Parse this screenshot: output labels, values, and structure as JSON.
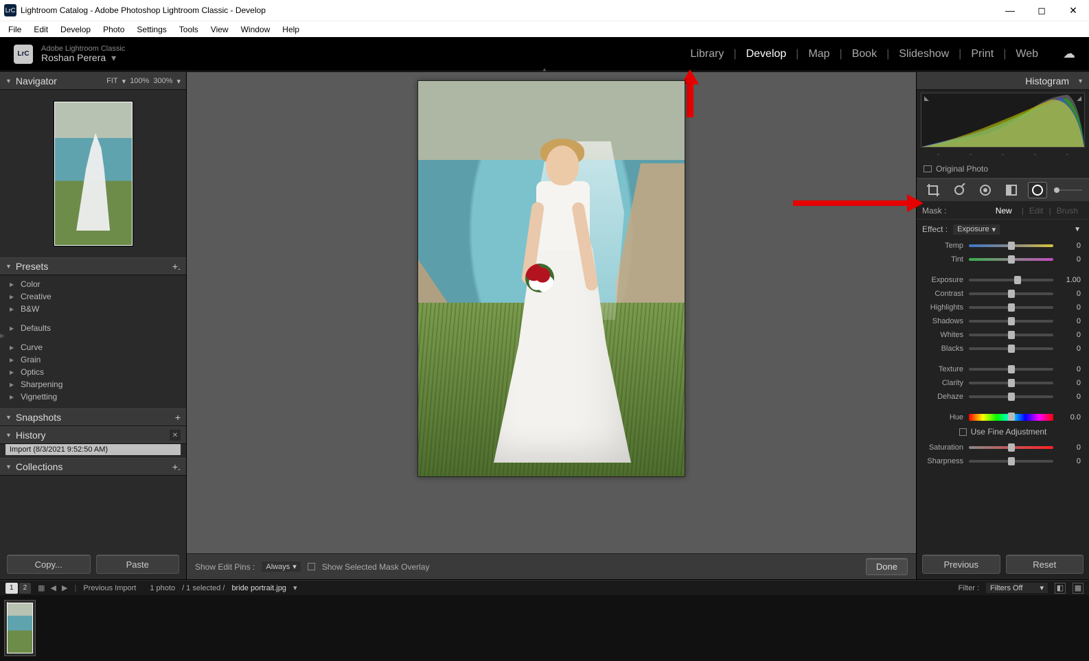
{
  "window": {
    "title": "Lightroom Catalog - Adobe Photoshop Lightroom Classic - Develop"
  },
  "menu": [
    "File",
    "Edit",
    "Develop",
    "Photo",
    "Settings",
    "Tools",
    "View",
    "Window",
    "Help"
  ],
  "brand": {
    "product": "Adobe Lightroom Classic",
    "user": "Roshan Perera"
  },
  "topnav": {
    "items": [
      "Library",
      "Develop",
      "Map",
      "Book",
      "Slideshow",
      "Print",
      "Web"
    ],
    "active": "Develop"
  },
  "left": {
    "navigator": {
      "title": "Navigator",
      "mode": "FIT",
      "zoom1": "100%",
      "zoom2": "300%"
    },
    "presets": {
      "title": "Presets",
      "groups_top": [
        "Color",
        "Creative",
        "B&W"
      ],
      "groups_mid": [
        "Defaults"
      ],
      "groups_bottom": [
        "Curve",
        "Grain",
        "Optics",
        "Sharpening",
        "Vignetting"
      ]
    },
    "snapshots": {
      "title": "Snapshots"
    },
    "history": {
      "title": "History",
      "item": "Import (8/3/2021 9:52:50 AM)"
    },
    "collections": {
      "title": "Collections"
    },
    "buttons": {
      "copy": "Copy...",
      "paste": "Paste"
    }
  },
  "center": {
    "edit_pins_label": "Show Edit Pins :",
    "edit_pins_value": "Always",
    "mask_overlay": "Show Selected Mask Overlay",
    "done": "Done"
  },
  "right": {
    "histogram_title": "Histogram",
    "original_photo": "Original Photo",
    "mask": {
      "label": "Mask :",
      "new": "New",
      "edit": "Edit",
      "brush": "Brush"
    },
    "effect": {
      "label": "Effect :",
      "value": "Exposure"
    },
    "sliders": [
      {
        "label": "Temp",
        "value": "0",
        "pos": 50,
        "cls": "temp-grad"
      },
      {
        "label": "Tint",
        "value": "0",
        "pos": 50,
        "cls": "tint-grad"
      }
    ],
    "sliders2": [
      {
        "label": "Exposure",
        "value": "1.00",
        "pos": 58
      },
      {
        "label": "Contrast",
        "value": "0",
        "pos": 50
      },
      {
        "label": "Highlights",
        "value": "0",
        "pos": 50
      },
      {
        "label": "Shadows",
        "value": "0",
        "pos": 50
      },
      {
        "label": "Whites",
        "value": "0",
        "pos": 50
      },
      {
        "label": "Blacks",
        "value": "0",
        "pos": 50
      }
    ],
    "sliders3": [
      {
        "label": "Texture",
        "value": "0",
        "pos": 50
      },
      {
        "label": "Clarity",
        "value": "0",
        "pos": 50
      },
      {
        "label": "Dehaze",
        "value": "0",
        "pos": 50
      }
    ],
    "hue": {
      "label": "Hue",
      "value": "0.0",
      "pos": 50
    },
    "fine": "Use Fine Adjustment",
    "sliders4": [
      {
        "label": "Saturation",
        "value": "0",
        "pos": 50,
        "cls": "sat-grad"
      },
      {
        "label": "Sharpness",
        "value": "0",
        "pos": 50
      }
    ],
    "buttons": {
      "prev": "Previous",
      "reset": "Reset"
    }
  },
  "filmstrip": {
    "pills": [
      "1",
      "2"
    ],
    "crumb_source": "Previous Import",
    "crumb_count": "1 photo",
    "crumb_sel": "/ 1 selected /",
    "crumb_file": "bride portrait.jpg",
    "filter_label": "Filter :",
    "filter_value": "Filters Off"
  }
}
